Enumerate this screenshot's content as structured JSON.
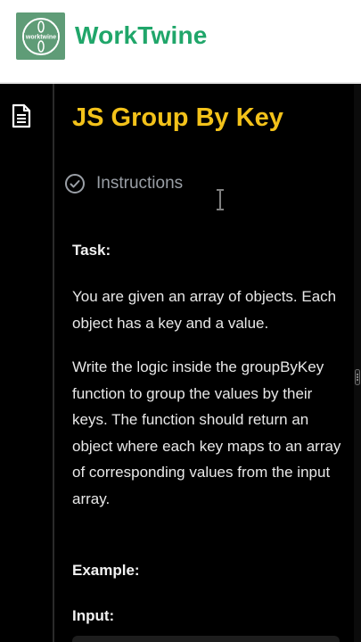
{
  "brand": {
    "logo_text": "worktwine",
    "name": "WorkTwine"
  },
  "sidebar": {
    "icon": "document-icon"
  },
  "content": {
    "title": "JS Group By Key",
    "section": {
      "icon": "check-circle-icon",
      "label": "Instructions"
    },
    "task_label": "Task:",
    "paragraph_1": "You are given an array of objects. Each object has a key and a value.",
    "paragraph_2": "Write the logic inside the groupByKey function to group the values by their keys. The function should return an object where each key maps to an array of corresponding values from the input array.",
    "example_label": "Example:",
    "input_label": "Input:"
  },
  "colors": {
    "brand_green": "#20a66a",
    "title_yellow": "#f3c21a",
    "panel_bg": "#000000",
    "muted_text": "#9a9fa6"
  }
}
